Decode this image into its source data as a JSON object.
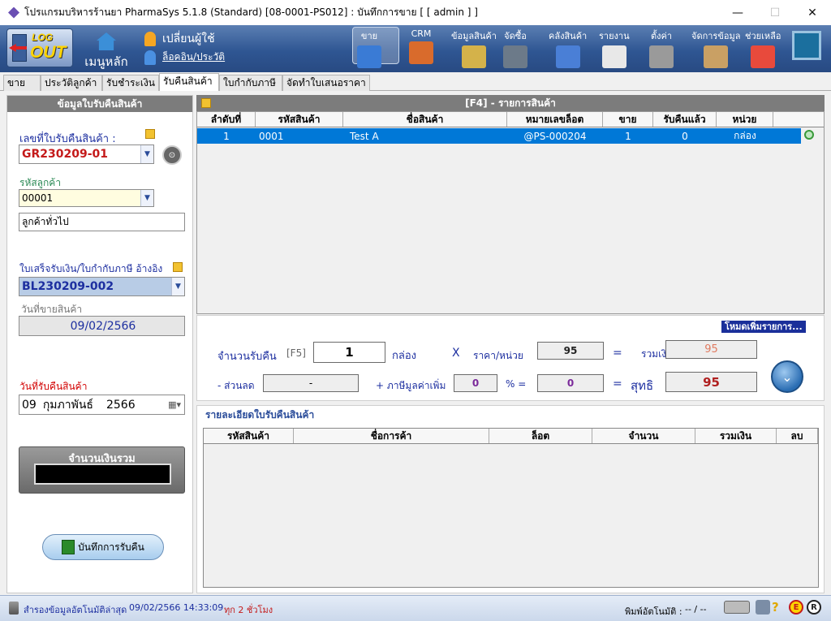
{
  "window": {
    "title": "โปรแกรมบริหารร้านยา PharmaSys 5.1.8 (Standard) [08-0001-PS012] : บันทึกการขาย  [ [ admin ] ]",
    "minimize": "—",
    "maximize": "☐",
    "close": "✕"
  },
  "toolbar": {
    "logout_top": "LOG",
    "logout_bottom": "OUT",
    "home": "เมนูหลัก",
    "switch_user": "เปลี่ยนผู้ใช้",
    "login_history": "ล็อคอิน/ประวัติ",
    "items": [
      {
        "label": "ขาย",
        "icon": "sale-icon",
        "color": "#3a7bd5"
      },
      {
        "label": "CRM",
        "icon": "crm-icon",
        "color": "#d96b2c"
      },
      {
        "label": "ข้อมูลสินค้า",
        "icon": "product-icon",
        "color": "#d4b24a"
      },
      {
        "label": "จัดซื้อ",
        "icon": "purchase-icon",
        "color": "#6c7a89"
      },
      {
        "label": "คลังสินค้า",
        "icon": "warehouse-icon",
        "color": "#4a7fd6"
      },
      {
        "label": "รายงาน",
        "icon": "report-icon",
        "color": "#e8e8e8"
      },
      {
        "label": "ตั้งค่า",
        "icon": "settings-icon",
        "color": "#9a9a9a"
      },
      {
        "label": "จัดการข้อมูล",
        "icon": "data-icon",
        "color": "#c9a064"
      },
      {
        "label": "ช่วยเหลือ",
        "icon": "help-icon",
        "color": "#e84a3c"
      }
    ]
  },
  "tabs": [
    "ขาย",
    "ประวัติลูกค้า",
    "รับชำระเงิน",
    "รับคืนสินค้า",
    "ใบกำกับภาษี",
    "จัดทำใบเสนอราคา"
  ],
  "active_tab": "รับคืนสินค้า",
  "left": {
    "header": "ข้อมูลใบรับคืนสินค้า",
    "doc_no_label": "เลขที่ใบรับคืนสินค้า :",
    "doc_no_value": "GR230209-01",
    "customer_code_label": "รหัสลูกค้า",
    "customer_code_value": "00001",
    "customer_name": "ลูกค้าทั่วไป",
    "ref_label": "ใบเสร็จรับเงิน/ใบกำกับภาษี อ้างอิง",
    "ref_value": "BL230209-002",
    "sale_date_label": "วันที่ขายสินค้า",
    "sale_date_value": "09/02/2566",
    "return_date_label": "วันที่รับคืนสินค้า",
    "return_date_day": "09",
    "return_date_month": "กุมภาพันธ์",
    "return_date_year": "2566",
    "total_label": "จำนวนเงินรวม",
    "save_label": "บันทึกการรับคืน"
  },
  "list": {
    "header": "[F4] - รายการสินค้า",
    "columns": [
      "ลำดับที่",
      "รหัสสินค้า",
      "ชื่อสินค้า",
      "หมายเลขล็อต",
      "ขาย",
      "รับคืนแล้ว",
      "หน่วย"
    ],
    "rows": [
      [
        "1",
        "0001",
        "Test A",
        "@PS-000204",
        "1",
        "0",
        "กล่อง"
      ]
    ]
  },
  "entry": {
    "mode_label": "โหมดเพิ่มรายการ...",
    "qty_label": "จำนวนรับคืน",
    "qty_key": "[F5]",
    "qty_value": "1",
    "unit": "กล่อง",
    "times": "X",
    "price_label": "ราคา/หน่วย",
    "price_value": "95",
    "equals": "=",
    "sum_label": "รวมเงิน",
    "sum_value": "95",
    "discount_label": "- ส่วนลด",
    "discount_value": "-",
    "vat_label": "+ ภาษีมูลค่าเพิ่ม",
    "vat_percent": "0",
    "percent_eq": "% =",
    "vat_value": "0",
    "net_label": "สุทธิ",
    "net_value": "95"
  },
  "detail": {
    "caption": "รายละเอียดใบรับคืนสินค้า",
    "columns": [
      "รหัสสินค้า",
      "ชื่อการค้า",
      "ล็อต",
      "จำนวน",
      "รวมเงิน",
      "ลบ"
    ]
  },
  "status": {
    "backup_text": "สำรองข้อมูลอัตโนมัติล่าสุด",
    "backup_time": "09/02/2566 14:33:09",
    "backup_interval": "ทุก 2 ชั่วโมง",
    "auto_print_label": "พิมพ์อัตโนมัติ :",
    "auto_print_value": "--  /  --"
  }
}
